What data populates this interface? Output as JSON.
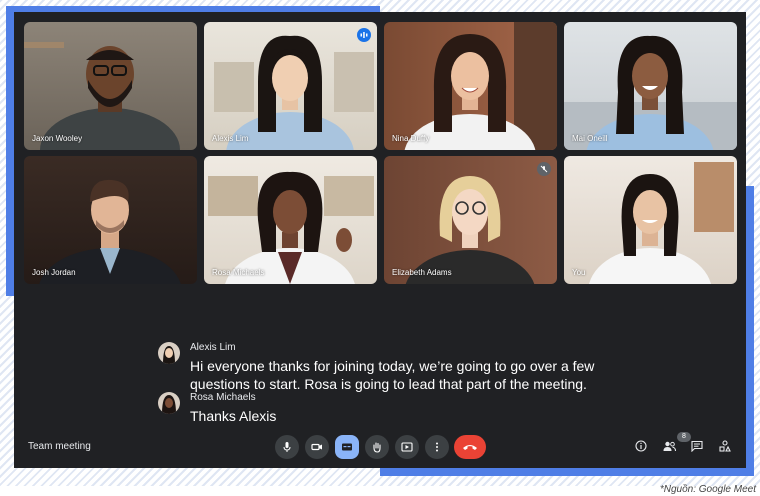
{
  "colors": {
    "window_bg": "#202124",
    "accent_blue": "#4f7ee6",
    "end_call_red": "#ea4335",
    "captions_active": "#8ab4f8"
  },
  "participants": [
    {
      "name": "Jaxon Wooley",
      "indicator_icon": ""
    },
    {
      "name": "Alexis Lim",
      "indicator_icon": "speaking-icon"
    },
    {
      "name": "Nina Duffy",
      "indicator_icon": ""
    },
    {
      "name": "Mai Oneill",
      "indicator_icon": ""
    },
    {
      "name": "Josh Jordan",
      "indicator_icon": ""
    },
    {
      "name": "Rosa Michaels",
      "indicator_icon": ""
    },
    {
      "name": "Elizabeth Adams",
      "indicator_icon": "mic-off-icon"
    },
    {
      "name": "You",
      "indicator_icon": ""
    }
  ],
  "captions": [
    {
      "speaker": "Alexis Lim",
      "text": "Hi everyone thanks for joining today, we’re going to go over a few questions to start. Rosa is going to lead that part of the meeting."
    },
    {
      "speaker": "Rosa Michaels",
      "text": "Thanks Alexis"
    }
  ],
  "bottom_bar": {
    "meeting_title": "Team meeting",
    "controls": [
      "mic-icon",
      "camera-icon",
      "captions-icon",
      "raise-hand-icon",
      "present-icon",
      "more-icon",
      "end-call-icon"
    ],
    "right_icons": [
      "info-icon",
      "people-icon",
      "chat-icon",
      "activities-icon"
    ],
    "people_count": "8"
  },
  "source_note": "*Nguồn: Google Meet"
}
